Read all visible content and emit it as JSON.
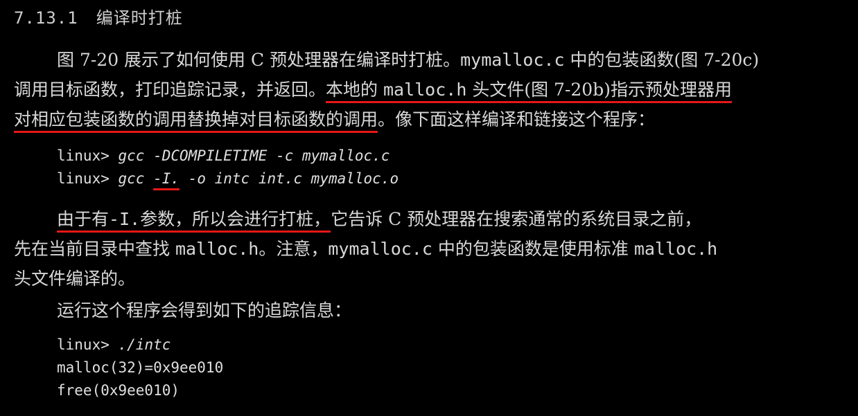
{
  "heading": {
    "number": "7.13.1",
    "title": "编译时打桩"
  },
  "para1": {
    "l1_a": "图 7-20 展示了如何使用 C 预处理器在编译时打桩。",
    "l1_code": "mymalloc.c",
    "l1_b": " 中的包装函数(图 7-20c)",
    "l2_a": "调用目标函数，打印追踪记录，并返回。",
    "l2_ul_a": "本地的 ",
    "l2_ul_code": "malloc.h",
    "l2_ul_b": " 头文件(图 7-20b)指示预处理器用",
    "l3_ul": "对相应包装函数的调用替换掉对目标函数的调用",
    "l3_b": "。像下面这样编译和链接这个程序："
  },
  "code1": {
    "prompt1": "linux> ",
    "cmd1": "gcc -DCOMPILETIME -c mymalloc.c",
    "prompt2": "linux> ",
    "cmd2_a": "gcc ",
    "cmd2_ul": "-I.",
    "cmd2_b": " -o intc int.c mymalloc.o"
  },
  "para2": {
    "l1_ul_a": "由于有",
    "l1_ul_code": "-I.",
    "l1_ul_b": "参数，所以会进行打桩，",
    "l1_b": "它告诉 C 预处理器在搜索通常的系统目录之前，",
    "l2_a": "先在当前目录中查找 ",
    "l2_code1": "malloc.h",
    "l2_b": "。注意，",
    "l2_code2": "mymalloc.c",
    "l2_c": " 中的包装函数是使用标准 ",
    "l2_code3": "malloc.h",
    "l3": "头文件编译的。"
  },
  "para3": {
    "text": "运行这个程序会得到如下的追踪信息："
  },
  "code2": {
    "prompt": "linux> ",
    "cmd": "./intc",
    "out1": "malloc(32)=0x9ee010",
    "out2": "free(0x9ee010)"
  },
  "colors": {
    "background": "#000000",
    "text": "#d8d8d8",
    "underline": "#e81717"
  }
}
